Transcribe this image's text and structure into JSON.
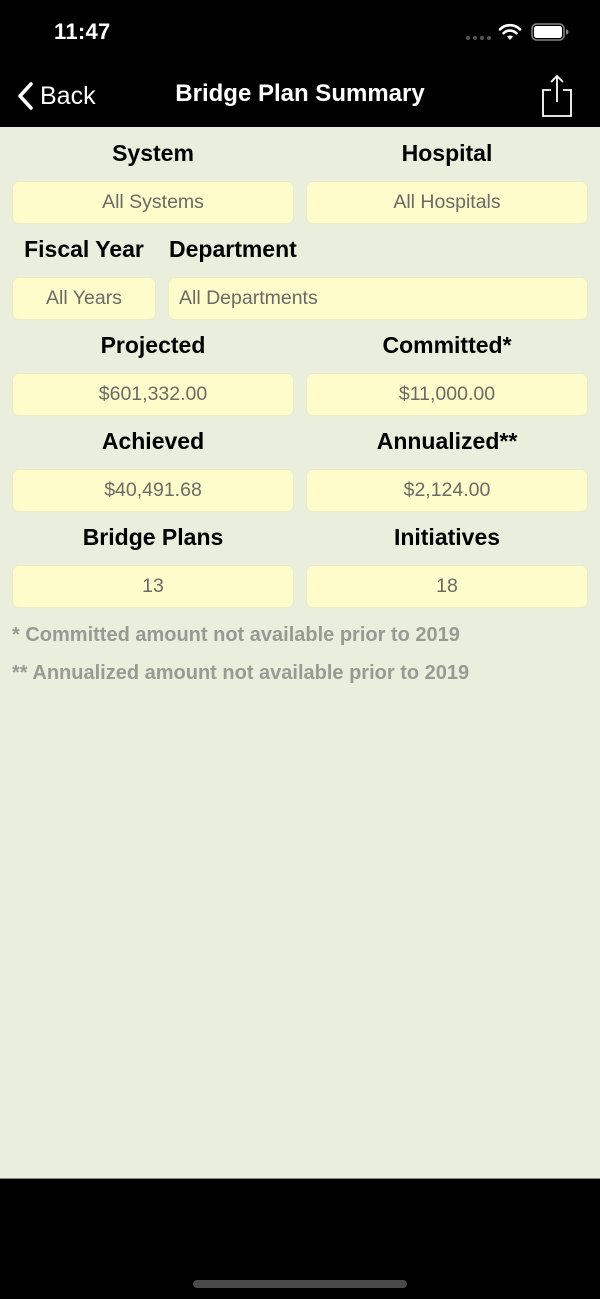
{
  "status_bar": {
    "time": "11:47",
    "icons": [
      "signal-dots-icon",
      "wifi-icon",
      "battery-icon"
    ]
  },
  "nav": {
    "back_label": "Back",
    "title": "Bridge Plan Summary",
    "share_icon": "share-icon"
  },
  "filters": {
    "system": {
      "label": "System",
      "value": "All Systems"
    },
    "hospital": {
      "label": "Hospital",
      "value": "All Hospitals"
    },
    "fiscal_year": {
      "label": "Fiscal Year",
      "value": "All Years"
    },
    "department": {
      "label": "Department",
      "value": "All Departments"
    }
  },
  "metrics": {
    "projected": {
      "label": "Projected",
      "value": "$601,332.00"
    },
    "committed": {
      "label": "Committed*",
      "value": "$11,000.00"
    },
    "achieved": {
      "label": "Achieved",
      "value": "$40,491.68"
    },
    "annualized": {
      "label": "Annualized**",
      "value": "$2,124.00"
    },
    "bridge_plans": {
      "label": "Bridge Plans",
      "value": "13"
    },
    "initiatives": {
      "label": "Initiatives",
      "value": "18"
    }
  },
  "notes": [
    "* Committed amount not available prior to 2019",
    "** Annualized amount not available prior to 2019"
  ],
  "colors": {
    "background": "#e9eedd",
    "field_background": "#fffccb",
    "bar_background": "#000000",
    "note_text": "#9a9a94"
  }
}
